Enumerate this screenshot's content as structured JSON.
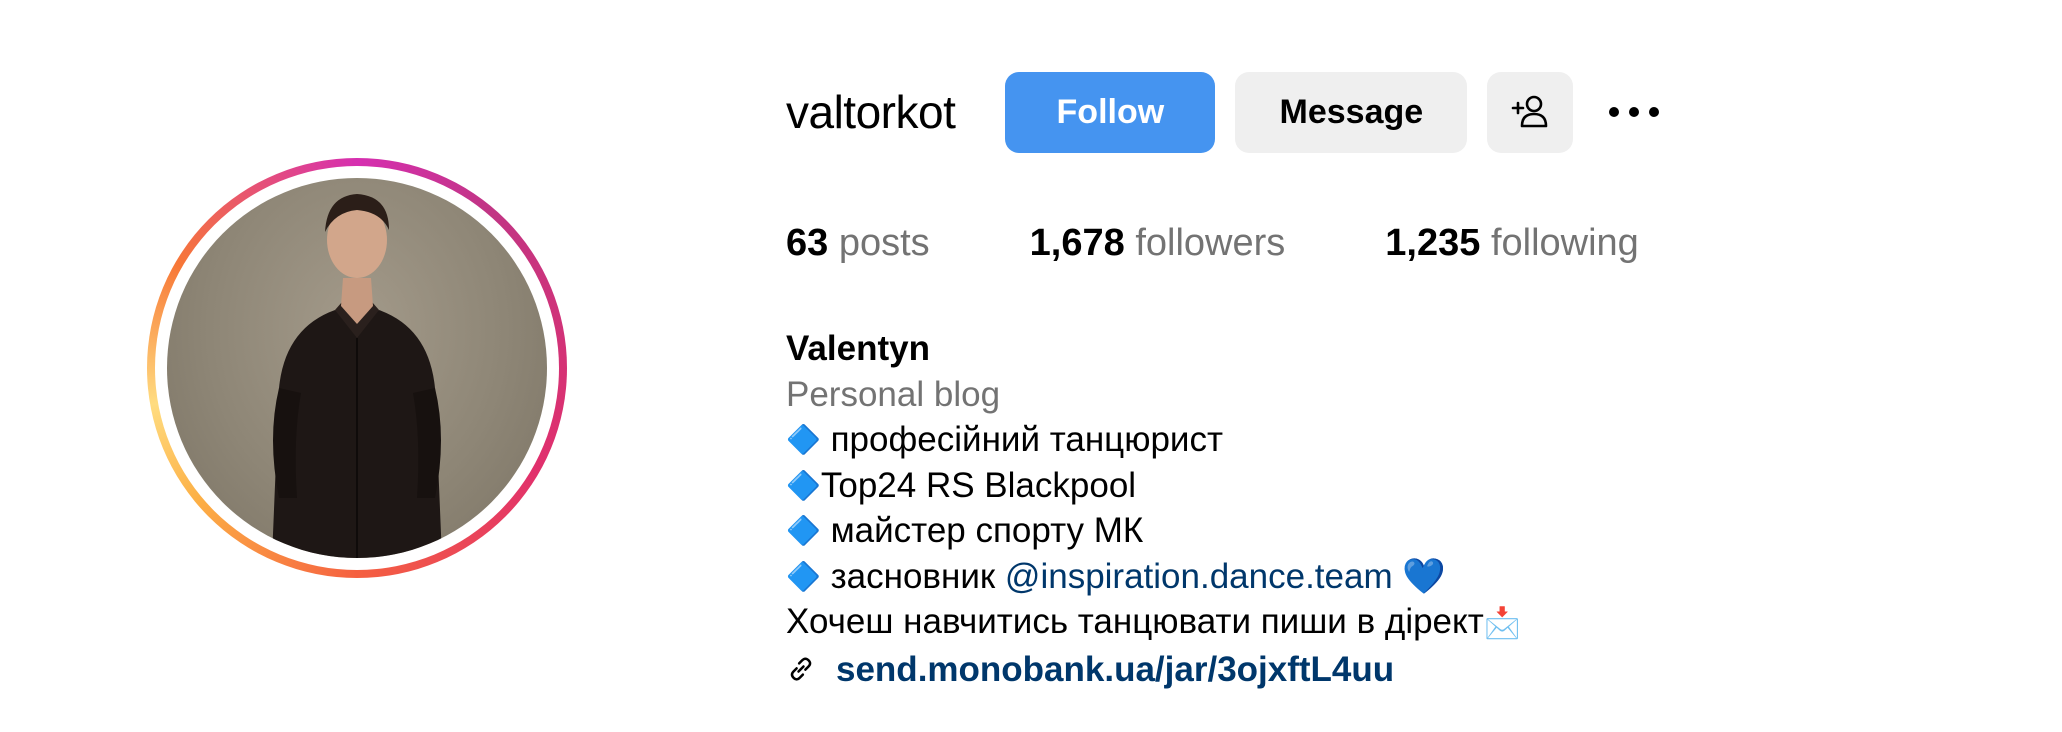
{
  "profile": {
    "username": "valtorkot",
    "buttons": {
      "follow": "Follow",
      "message": "Message"
    },
    "icons": {
      "add_user": "add-user-icon",
      "more": "more-options-icon",
      "link": "link-icon"
    },
    "stats": {
      "posts_count": "63",
      "posts_label": "posts",
      "followers_count": "1,678",
      "followers_label": "followers",
      "following_count": "1,235",
      "following_label": "following"
    },
    "bio": {
      "name": "Valentyn",
      "category": "Personal blog",
      "diamond": "🔷",
      "line1": " професійний танцюрист",
      "line2": "Top24 RS Blackpool",
      "line3": " майстер спорту МК",
      "line4_prefix": " засновник ",
      "line4_mention": "@inspiration.dance.team",
      "line4_heart": " 💙",
      "line5": "Хочеш навчитись танцювати пиши в дірект",
      "line5_emoji": "📩",
      "link": "send.monobank.ua/jar/3ojxftL4uu"
    }
  },
  "colors": {
    "follow_button": "#4594f0",
    "secondary_button": "#efefef",
    "muted_text": "#737373",
    "link_text": "#00376b"
  }
}
